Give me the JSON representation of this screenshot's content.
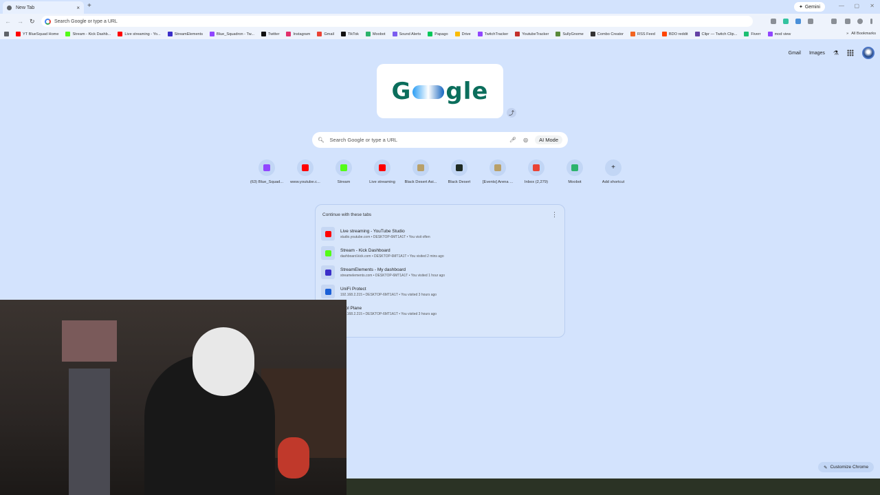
{
  "tab": {
    "title": "New Tab",
    "close": "×",
    "new": "+"
  },
  "gemini": {
    "label": "Gemini",
    "icon": "✦"
  },
  "window": {
    "min": "—",
    "max": "▢",
    "close": "✕"
  },
  "toolbar": {
    "back": "←",
    "forward": "→",
    "reload": "↻",
    "omnibox_placeholder": "Search Google or type a URL"
  },
  "bookmarks": [
    {
      "label": "YT BlueSquad Home",
      "color": "#ff0000"
    },
    {
      "label": "Stream - Kick Dashb...",
      "color": "#53fc18"
    },
    {
      "label": "Live streaming - Yo...",
      "color": "#ff0000"
    },
    {
      "label": "StreamElements",
      "color": "#3b2fc9"
    },
    {
      "label": "Blue_Squadron - Tw...",
      "color": "#9146ff"
    },
    {
      "label": "Twitter",
      "color": "#111111"
    },
    {
      "label": "Instagram",
      "color": "#e1306c"
    },
    {
      "label": "Gmail",
      "color": "#ea4335"
    },
    {
      "label": "TikTok",
      "color": "#111111"
    },
    {
      "label": "Moobot",
      "color": "#2db36c"
    },
    {
      "label": "Sound Alerts",
      "color": "#7b5cf0"
    },
    {
      "label": "Papago",
      "color": "#03c75a"
    },
    {
      "label": "Drive",
      "color": "#fbbc04"
    },
    {
      "label": "TwitchTracker",
      "color": "#9146ff"
    },
    {
      "label": "YoutubeTracker",
      "color": "#c4302b"
    },
    {
      "label": "SullyGnome",
      "color": "#5a8a3a"
    },
    {
      "label": "Combo Creator",
      "color": "#333333"
    },
    {
      "label": "RSS Feed",
      "color": "#f26522"
    },
    {
      "label": "BDO reddit",
      "color": "#ff4500"
    },
    {
      "label": "Clipr — Twitch Clip...",
      "color": "#6441a5"
    },
    {
      "label": "Fiverr",
      "color": "#1dbf73"
    },
    {
      "label": "mod view",
      "color": "#9146ff"
    }
  ],
  "bookmarks_more": "»",
  "all_bookmarks": "All Bookmarks",
  "toplinks": {
    "gmail": "Gmail",
    "images": "Images"
  },
  "doodle": {
    "left": "G",
    "right": "gle"
  },
  "search": {
    "placeholder": "Search Google or type a URL",
    "ai_mode": "AI Mode"
  },
  "shortcuts": [
    {
      "label": "(63) Blue_Squad...",
      "color": "#9146ff"
    },
    {
      "label": "www.youtube.c...",
      "color": "#ff0000"
    },
    {
      "label": "Stream",
      "color": "#53fc18"
    },
    {
      "label": "Live streaming",
      "color": "#ff0000"
    },
    {
      "label": "Black Desert Asi...",
      "color": "#b8a06a"
    },
    {
      "label": "Black Desert",
      "color": "#1e2a22"
    },
    {
      "label": "[Events] Arena ...",
      "color": "#b8a06a"
    },
    {
      "label": "Inbox (2,279)",
      "color": "#ea4335"
    },
    {
      "label": "Moobot",
      "color": "#2db36c"
    },
    {
      "label": "Add shortcut",
      "color": "#444444"
    }
  ],
  "continue": {
    "title": "Continue with these tabs",
    "items": [
      {
        "title": "Live streaming - YouTube Studio",
        "sub": "studio.youtube.com • DESKTOP-6MT1A1T • You visit often",
        "color": "#ff0000"
      },
      {
        "title": "Stream - Kick Dashboard",
        "sub": "dashboard.kick.com • DESKTOP-6MT1A1T • You visited 2 mins ago",
        "color": "#53fc18"
      },
      {
        "title": "StreamElements - My dashboard",
        "sub": "streamelements.com • DESKTOP-6MT1A1T • You visited 1 hour ago",
        "color": "#3b2fc9"
      },
      {
        "title": "UniFi Protect",
        "sub": "192.168.2.215 • DESKTOP-6MT1A1T • You visited 3 hours ago",
        "color": "#1a5fd6"
      },
      {
        "title": "ntrol Plane",
        "sub": "192.168.2.215 • DESKTOP-6MT1A1T • You visited 3 hours ago",
        "color": "#1a5fd6"
      }
    ]
  },
  "customize": {
    "label": "Customize Chrome",
    "icon": "✎"
  }
}
